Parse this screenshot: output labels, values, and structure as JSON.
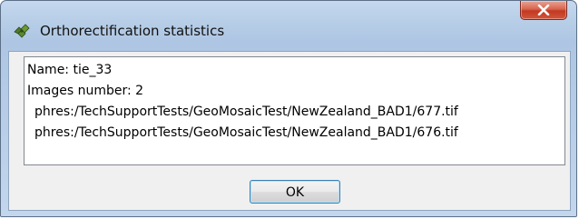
{
  "window": {
    "title": "Orthorectification statistics",
    "app_icon": "satellite-leaf-icon",
    "close_icon": "close-icon"
  },
  "statistics": {
    "name_line": "Name: tie_33",
    "images_number_line": "Images number: 2",
    "image_paths": [
      "phres:/TechSupportTests/GeoMosaicTest/NewZealand_BAD1/677.tif",
      "phres:/TechSupportTests/GeoMosaicTest/NewZealand_BAD1/676.tif"
    ]
  },
  "buttons": {
    "ok_label": "OK"
  },
  "colors": {
    "titlebar": "#b9cfe8",
    "close_button": "#c33a22",
    "dialog_background": "#f0f0f0",
    "ok_border": "#3c7fb1"
  }
}
